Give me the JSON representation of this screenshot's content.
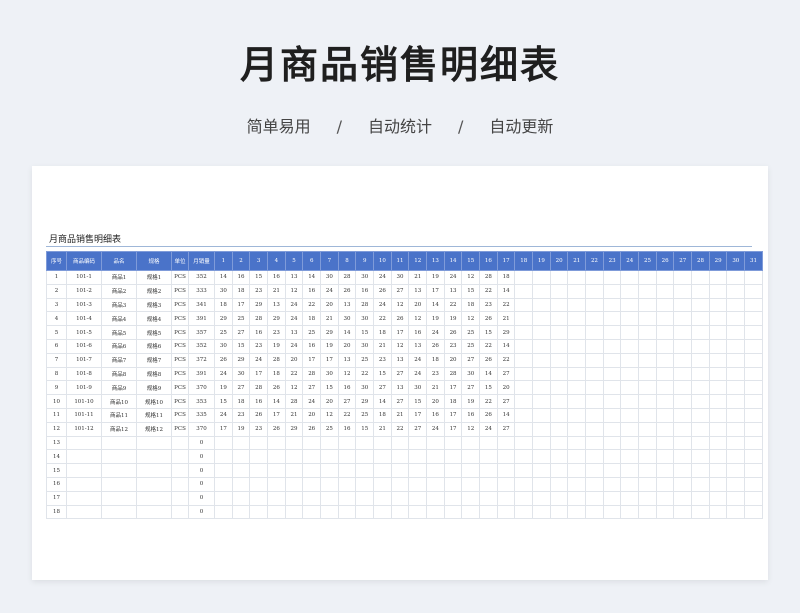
{
  "title": "月商品销售明细表",
  "subtitle": {
    "items": [
      "简单易用",
      "自动统计",
      "自动更新"
    ],
    "separator": "/"
  },
  "sheet": {
    "title": "月商品销售明细表",
    "header_color": "#4a73c9",
    "columns": [
      "序号",
      "商品编码",
      "品名",
      "规格",
      "单位",
      "月销量",
      "1",
      "2",
      "3",
      "4",
      "5",
      "6",
      "7",
      "8",
      "9",
      "10",
      "11",
      "12",
      "13",
      "14",
      "15",
      "16",
      "17",
      "18",
      "19",
      "20",
      "21",
      "22",
      "23",
      "24",
      "25",
      "26",
      "27",
      "28",
      "29",
      "30",
      "31"
    ],
    "rows": [
      [
        "1",
        "101-1",
        "商品1",
        "规格1",
        "PCS",
        "352",
        "14",
        "16",
        "15",
        "16",
        "13",
        "14",
        "30",
        "28",
        "30",
        "24",
        "30",
        "21",
        "19",
        "24",
        "12",
        "28",
        "18"
      ],
      [
        "2",
        "101-2",
        "商品2",
        "规格2",
        "PCS",
        "333",
        "30",
        "18",
        "23",
        "21",
        "12",
        "16",
        "24",
        "26",
        "16",
        "26",
        "27",
        "13",
        "17",
        "13",
        "15",
        "22",
        "14"
      ],
      [
        "3",
        "101-3",
        "商品3",
        "规格3",
        "PCS",
        "341",
        "18",
        "17",
        "29",
        "13",
        "24",
        "22",
        "20",
        "13",
        "28",
        "24",
        "12",
        "20",
        "14",
        "22",
        "18",
        "23",
        "22"
      ],
      [
        "4",
        "101-4",
        "商品4",
        "规格4",
        "PCS",
        "391",
        "29",
        "25",
        "28",
        "29",
        "24",
        "18",
        "21",
        "30",
        "30",
        "22",
        "26",
        "12",
        "19",
        "19",
        "12",
        "26",
        "21"
      ],
      [
        "5",
        "101-5",
        "商品5",
        "规格5",
        "PCS",
        "357",
        "25",
        "27",
        "16",
        "23",
        "13",
        "25",
        "29",
        "14",
        "15",
        "18",
        "17",
        "16",
        "24",
        "26",
        "25",
        "15",
        "29"
      ],
      [
        "6",
        "101-6",
        "商品6",
        "规格6",
        "PCS",
        "352",
        "30",
        "15",
        "23",
        "19",
        "24",
        "16",
        "19",
        "20",
        "30",
        "21",
        "12",
        "13",
        "26",
        "23",
        "25",
        "22",
        "14"
      ],
      [
        "7",
        "101-7",
        "商品7",
        "规格7",
        "PCS",
        "372",
        "26",
        "29",
        "24",
        "28",
        "20",
        "17",
        "17",
        "13",
        "25",
        "23",
        "13",
        "24",
        "18",
        "20",
        "27",
        "26",
        "22"
      ],
      [
        "8",
        "101-8",
        "商品8",
        "规格8",
        "PCS",
        "391",
        "24",
        "30",
        "17",
        "18",
        "22",
        "28",
        "30",
        "12",
        "22",
        "15",
        "27",
        "24",
        "23",
        "28",
        "30",
        "14",
        "27"
      ],
      [
        "9",
        "101-9",
        "商品9",
        "规格9",
        "PCS",
        "370",
        "19",
        "27",
        "28",
        "26",
        "12",
        "27",
        "15",
        "16",
        "30",
        "27",
        "13",
        "30",
        "21",
        "17",
        "27",
        "15",
        "20"
      ],
      [
        "10",
        "101-10",
        "商品10",
        "规格10",
        "PCS",
        "353",
        "15",
        "18",
        "16",
        "14",
        "28",
        "24",
        "20",
        "27",
        "29",
        "14",
        "27",
        "15",
        "20",
        "18",
        "19",
        "22",
        "27"
      ],
      [
        "11",
        "101-11",
        "商品11",
        "规格11",
        "PCS",
        "335",
        "24",
        "23",
        "26",
        "17",
        "21",
        "20",
        "12",
        "22",
        "25",
        "18",
        "21",
        "17",
        "16",
        "17",
        "16",
        "26",
        "14"
      ],
      [
        "12",
        "101-12",
        "商品12",
        "规格12",
        "PCS",
        "370",
        "17",
        "19",
        "23",
        "26",
        "29",
        "26",
        "25",
        "16",
        "15",
        "21",
        "22",
        "27",
        "24",
        "17",
        "12",
        "24",
        "27"
      ],
      [
        "13",
        "",
        "",
        "",
        "",
        "0"
      ],
      [
        "14",
        "",
        "",
        "",
        "",
        "0"
      ],
      [
        "15",
        "",
        "",
        "",
        "",
        "0"
      ],
      [
        "16",
        "",
        "",
        "",
        "",
        "0"
      ],
      [
        "17",
        "",
        "",
        "",
        "",
        "0"
      ],
      [
        "18",
        "",
        "",
        "",
        "",
        "0"
      ]
    ]
  }
}
